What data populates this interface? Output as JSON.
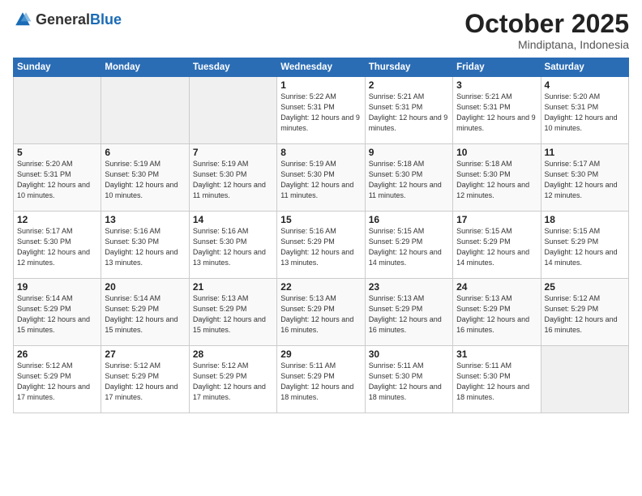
{
  "header": {
    "logo_general": "General",
    "logo_blue": "Blue",
    "month_year": "October 2025",
    "location": "Mindiptana, Indonesia"
  },
  "days_of_week": [
    "Sunday",
    "Monday",
    "Tuesday",
    "Wednesday",
    "Thursday",
    "Friday",
    "Saturday"
  ],
  "weeks": [
    [
      {
        "day": "",
        "sunrise": "",
        "sunset": "",
        "daylight": ""
      },
      {
        "day": "",
        "sunrise": "",
        "sunset": "",
        "daylight": ""
      },
      {
        "day": "",
        "sunrise": "",
        "sunset": "",
        "daylight": ""
      },
      {
        "day": "1",
        "sunrise": "Sunrise: 5:22 AM",
        "sunset": "Sunset: 5:31 PM",
        "daylight": "Daylight: 12 hours and 9 minutes."
      },
      {
        "day": "2",
        "sunrise": "Sunrise: 5:21 AM",
        "sunset": "Sunset: 5:31 PM",
        "daylight": "Daylight: 12 hours and 9 minutes."
      },
      {
        "day": "3",
        "sunrise": "Sunrise: 5:21 AM",
        "sunset": "Sunset: 5:31 PM",
        "daylight": "Daylight: 12 hours and 9 minutes."
      },
      {
        "day": "4",
        "sunrise": "Sunrise: 5:20 AM",
        "sunset": "Sunset: 5:31 PM",
        "daylight": "Daylight: 12 hours and 10 minutes."
      }
    ],
    [
      {
        "day": "5",
        "sunrise": "Sunrise: 5:20 AM",
        "sunset": "Sunset: 5:31 PM",
        "daylight": "Daylight: 12 hours and 10 minutes."
      },
      {
        "day": "6",
        "sunrise": "Sunrise: 5:19 AM",
        "sunset": "Sunset: 5:30 PM",
        "daylight": "Daylight: 12 hours and 10 minutes."
      },
      {
        "day": "7",
        "sunrise": "Sunrise: 5:19 AM",
        "sunset": "Sunset: 5:30 PM",
        "daylight": "Daylight: 12 hours and 11 minutes."
      },
      {
        "day": "8",
        "sunrise": "Sunrise: 5:19 AM",
        "sunset": "Sunset: 5:30 PM",
        "daylight": "Daylight: 12 hours and 11 minutes."
      },
      {
        "day": "9",
        "sunrise": "Sunrise: 5:18 AM",
        "sunset": "Sunset: 5:30 PM",
        "daylight": "Daylight: 12 hours and 11 minutes."
      },
      {
        "day": "10",
        "sunrise": "Sunrise: 5:18 AM",
        "sunset": "Sunset: 5:30 PM",
        "daylight": "Daylight: 12 hours and 12 minutes."
      },
      {
        "day": "11",
        "sunrise": "Sunrise: 5:17 AM",
        "sunset": "Sunset: 5:30 PM",
        "daylight": "Daylight: 12 hours and 12 minutes."
      }
    ],
    [
      {
        "day": "12",
        "sunrise": "Sunrise: 5:17 AM",
        "sunset": "Sunset: 5:30 PM",
        "daylight": "Daylight: 12 hours and 12 minutes."
      },
      {
        "day": "13",
        "sunrise": "Sunrise: 5:16 AM",
        "sunset": "Sunset: 5:30 PM",
        "daylight": "Daylight: 12 hours and 13 minutes."
      },
      {
        "day": "14",
        "sunrise": "Sunrise: 5:16 AM",
        "sunset": "Sunset: 5:30 PM",
        "daylight": "Daylight: 12 hours and 13 minutes."
      },
      {
        "day": "15",
        "sunrise": "Sunrise: 5:16 AM",
        "sunset": "Sunset: 5:29 PM",
        "daylight": "Daylight: 12 hours and 13 minutes."
      },
      {
        "day": "16",
        "sunrise": "Sunrise: 5:15 AM",
        "sunset": "Sunset: 5:29 PM",
        "daylight": "Daylight: 12 hours and 14 minutes."
      },
      {
        "day": "17",
        "sunrise": "Sunrise: 5:15 AM",
        "sunset": "Sunset: 5:29 PM",
        "daylight": "Daylight: 12 hours and 14 minutes."
      },
      {
        "day": "18",
        "sunrise": "Sunrise: 5:15 AM",
        "sunset": "Sunset: 5:29 PM",
        "daylight": "Daylight: 12 hours and 14 minutes."
      }
    ],
    [
      {
        "day": "19",
        "sunrise": "Sunrise: 5:14 AM",
        "sunset": "Sunset: 5:29 PM",
        "daylight": "Daylight: 12 hours and 15 minutes."
      },
      {
        "day": "20",
        "sunrise": "Sunrise: 5:14 AM",
        "sunset": "Sunset: 5:29 PM",
        "daylight": "Daylight: 12 hours and 15 minutes."
      },
      {
        "day": "21",
        "sunrise": "Sunrise: 5:13 AM",
        "sunset": "Sunset: 5:29 PM",
        "daylight": "Daylight: 12 hours and 15 minutes."
      },
      {
        "day": "22",
        "sunrise": "Sunrise: 5:13 AM",
        "sunset": "Sunset: 5:29 PM",
        "daylight": "Daylight: 12 hours and 16 minutes."
      },
      {
        "day": "23",
        "sunrise": "Sunrise: 5:13 AM",
        "sunset": "Sunset: 5:29 PM",
        "daylight": "Daylight: 12 hours and 16 minutes."
      },
      {
        "day": "24",
        "sunrise": "Sunrise: 5:13 AM",
        "sunset": "Sunset: 5:29 PM",
        "daylight": "Daylight: 12 hours and 16 minutes."
      },
      {
        "day": "25",
        "sunrise": "Sunrise: 5:12 AM",
        "sunset": "Sunset: 5:29 PM",
        "daylight": "Daylight: 12 hours and 16 minutes."
      }
    ],
    [
      {
        "day": "26",
        "sunrise": "Sunrise: 5:12 AM",
        "sunset": "Sunset: 5:29 PM",
        "daylight": "Daylight: 12 hours and 17 minutes."
      },
      {
        "day": "27",
        "sunrise": "Sunrise: 5:12 AM",
        "sunset": "Sunset: 5:29 PM",
        "daylight": "Daylight: 12 hours and 17 minutes."
      },
      {
        "day": "28",
        "sunrise": "Sunrise: 5:12 AM",
        "sunset": "Sunset: 5:29 PM",
        "daylight": "Daylight: 12 hours and 17 minutes."
      },
      {
        "day": "29",
        "sunrise": "Sunrise: 5:11 AM",
        "sunset": "Sunset: 5:29 PM",
        "daylight": "Daylight: 12 hours and 18 minutes."
      },
      {
        "day": "30",
        "sunrise": "Sunrise: 5:11 AM",
        "sunset": "Sunset: 5:30 PM",
        "daylight": "Daylight: 12 hours and 18 minutes."
      },
      {
        "day": "31",
        "sunrise": "Sunrise: 5:11 AM",
        "sunset": "Sunset: 5:30 PM",
        "daylight": "Daylight: 12 hours and 18 minutes."
      },
      {
        "day": "",
        "sunrise": "",
        "sunset": "",
        "daylight": ""
      }
    ]
  ]
}
